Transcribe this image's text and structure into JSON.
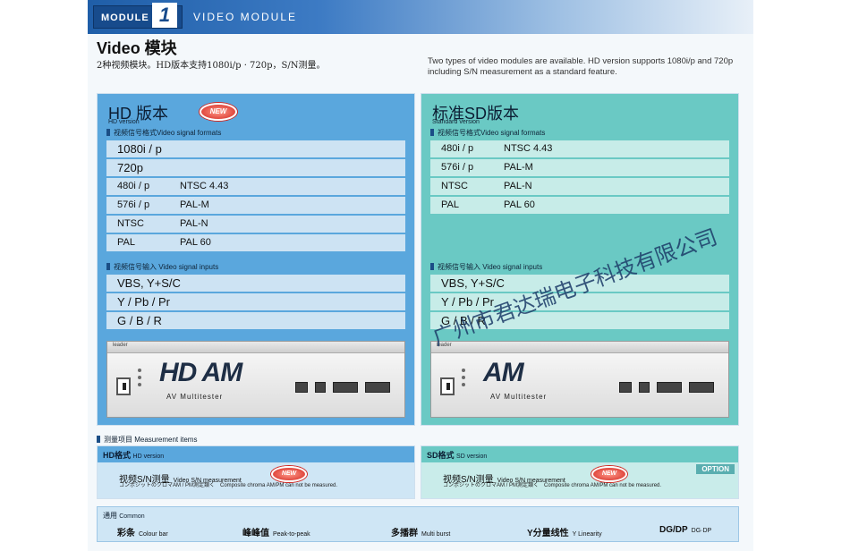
{
  "header": {
    "module_tag": "MODULE",
    "module_number": "1",
    "module_title": "VIDEO MODULE"
  },
  "page_title": "Video 模块",
  "intro": {
    "cn": "2种视频模块。HD版本支持1080i/p · 720p，S/N测量。",
    "en": "Two types of video modules are available. HD version supports 1080i/p and 720p including S/N measurement as a standard feature."
  },
  "hd_panel": {
    "title": "HD 版本",
    "subtitle": "HD version",
    "badge": "NEW",
    "formats_label": "视频信号格式Video signal formats",
    "formats": [
      {
        "a": "1080i / p",
        "b": ""
      },
      {
        "a": "720p",
        "b": ""
      },
      {
        "a": "480i / p",
        "b": "NTSC 4.43"
      },
      {
        "a": "576i / p",
        "b": "PAL-M"
      },
      {
        "a": "NTSC",
        "b": "PAL-N"
      },
      {
        "a": "PAL",
        "b": "PAL 60"
      }
    ],
    "inputs_label": "视频信号输入 Video signal inputs",
    "inputs": [
      "VBS, Y+S/C",
      "Y / Pb / Pr",
      "G / B / R"
    ],
    "device_logo": "HD AM",
    "device_sub": "AV Multitester",
    "device_brand": "leader"
  },
  "sd_panel": {
    "title": "标准SD版本",
    "subtitle": "Standard version",
    "formats_label": "视频信号格式Video signal formats",
    "formats": [
      {
        "a": "480i / p",
        "b": "NTSC 4.43"
      },
      {
        "a": "576i / p",
        "b": "PAL-M"
      },
      {
        "a": "NTSC",
        "b": "PAL-N"
      },
      {
        "a": "PAL",
        "b": "PAL 60"
      }
    ],
    "inputs_label": "视频信号输入 Video signal inputs",
    "inputs": [
      "VBS, Y+S/C",
      "Y / Pb / Pr",
      "G / B / R"
    ],
    "device_logo": "AM",
    "device_sub": "AV Multitester",
    "device_brand": "leader"
  },
  "measurement": {
    "label": "测量项目 Measurement items",
    "hd": {
      "title": "HD格式",
      "title_en": "HD version",
      "badge": "NEW",
      "item": "视频S/N测量",
      "item_en": "Video S/N measurement",
      "note": "コンポジットのクロマAM / PM測定類く　Composite chroma AM/PM can not be measured."
    },
    "sd": {
      "title": "SD格式",
      "title_en": "SD version",
      "badge": "NEW",
      "option": "OPTION",
      "item": "视频S/N测量",
      "item_en": "Video S/N measurement",
      "note": "コンポジットのクロマAM / PM測定類く　Composite chroma AM/PM can not be measured."
    }
  },
  "common": {
    "label": "通用",
    "label_en": "Common",
    "items": [
      {
        "cn": "彩条",
        "en": "Colour bar"
      },
      {
        "cn": "峰峰值",
        "en": "Peak-to-peak"
      },
      {
        "cn": "多播群",
        "en": "Multi burst"
      },
      {
        "cn": "Y分量线性",
        "en": "Y Linearity"
      },
      {
        "cn": "DG/DP",
        "en": "DG·DP"
      }
    ]
  },
  "watermark": "广州市君达瑞电子科技有限公司",
  "colors": {
    "hd_panel": "#5aa7dd",
    "sd_panel": "#6ac9c4",
    "header_blue": "#1f5ea8",
    "badge_red": "#d3261f"
  }
}
